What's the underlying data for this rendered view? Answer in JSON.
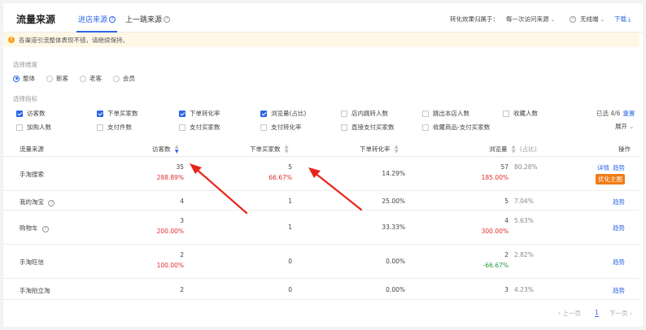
{
  "header": {
    "title": "流量来源",
    "tabs": [
      {
        "label": "进店来源",
        "active": true
      },
      {
        "label": "上一跳来源",
        "active": false
      }
    ],
    "attribution_label": "转化效果归属于：",
    "attribution_value": "每一次访问来源",
    "device_value": "无线端",
    "download_label": "下载"
  },
  "notice": {
    "text": "各渠道引流整体表现不错，请继续保持。"
  },
  "dimension": {
    "label": "选择维度",
    "options": [
      {
        "label": "整体",
        "selected": true
      },
      {
        "label": "新客",
        "selected": false
      },
      {
        "label": "老客",
        "selected": false
      },
      {
        "label": "会员",
        "selected": false
      }
    ]
  },
  "metrics": {
    "label": "选择指标",
    "items": [
      {
        "label": "访客数",
        "checked": true
      },
      {
        "label": "下单买家数",
        "checked": true
      },
      {
        "label": "下单转化率",
        "checked": true
      },
      {
        "label": "浏览量(占比)",
        "checked": true
      },
      {
        "label": "店内跳转人数",
        "checked": false
      },
      {
        "label": "跳出本店人数",
        "checked": false
      },
      {
        "label": "收藏人数",
        "checked": false
      },
      {
        "label": "加购人数",
        "checked": false
      },
      {
        "label": "支付件数",
        "checked": false
      },
      {
        "label": "支付买家数",
        "checked": false
      },
      {
        "label": "支付转化率",
        "checked": false
      },
      {
        "label": "直接支付买家数",
        "checked": false
      },
      {
        "label": "收藏商品-支付买家数",
        "checked": false
      }
    ],
    "selected_text": "已选 4/6",
    "reset_label": "重置",
    "expand_label": "展开"
  },
  "table": {
    "columns": {
      "source": "流量来源",
      "visitors": "访客数",
      "buyers": "下单买家数",
      "conversion": "下单转化率",
      "pageviews": "浏览量",
      "share": "(占比)",
      "ops": "操作"
    },
    "rows": [
      {
        "name": "手淘搜索",
        "help": false,
        "visitors": "35",
        "visitors_change": "288.89%",
        "buyers": "5",
        "buyers_change": "66.67%",
        "conversion": "14.29%",
        "pageviews": "57",
        "pv_change": "185.00%",
        "pv_change_neg": false,
        "share": "80.28%",
        "ops": [
          "详情",
          "趋势"
        ],
        "tag": "优化主图"
      },
      {
        "name": "我的淘宝",
        "help": true,
        "visitors": "4",
        "visitors_change": "",
        "buyers": "1",
        "buyers_change": "",
        "conversion": "25.00%",
        "pageviews": "5",
        "pv_change": "",
        "pv_change_neg": false,
        "share": "7.04%",
        "ops": [
          "趋势"
        ],
        "tag": ""
      },
      {
        "name": "购物车",
        "help": true,
        "visitors": "3",
        "visitors_change": "200.00%",
        "buyers": "1",
        "buyers_change": "",
        "conversion": "33.33%",
        "pageviews": "4",
        "pv_change": "300.00%",
        "pv_change_neg": false,
        "share": "5.63%",
        "ops": [
          "趋势"
        ],
        "tag": ""
      },
      {
        "name": "手淘旺信",
        "help": false,
        "visitors": "2",
        "visitors_change": "100.00%",
        "buyers": "0",
        "buyers_change": "",
        "conversion": "0.00%",
        "pageviews": "2",
        "pv_change": "-66.67%",
        "pv_change_neg": true,
        "share": "2.82%",
        "ops": [
          "趋势"
        ],
        "tag": ""
      },
      {
        "name": "手淘拍立淘",
        "help": false,
        "visitors": "2",
        "visitors_change": "",
        "buyers": "0",
        "buyers_change": "",
        "conversion": "0.00%",
        "pageviews": "3",
        "pv_change": "",
        "pv_change_neg": false,
        "share": "4.23%",
        "ops": [
          "趋势"
        ],
        "tag": ""
      }
    ]
  },
  "pagination": {
    "prev": "上一页",
    "current": "1",
    "next": "下一页"
  },
  "colors": {
    "accent": "#2b66e8",
    "increase": "#e02e2e",
    "decrease": "#1f9d3f",
    "tag": "#f07b14",
    "annotation_arrow": "#e8241c"
  }
}
